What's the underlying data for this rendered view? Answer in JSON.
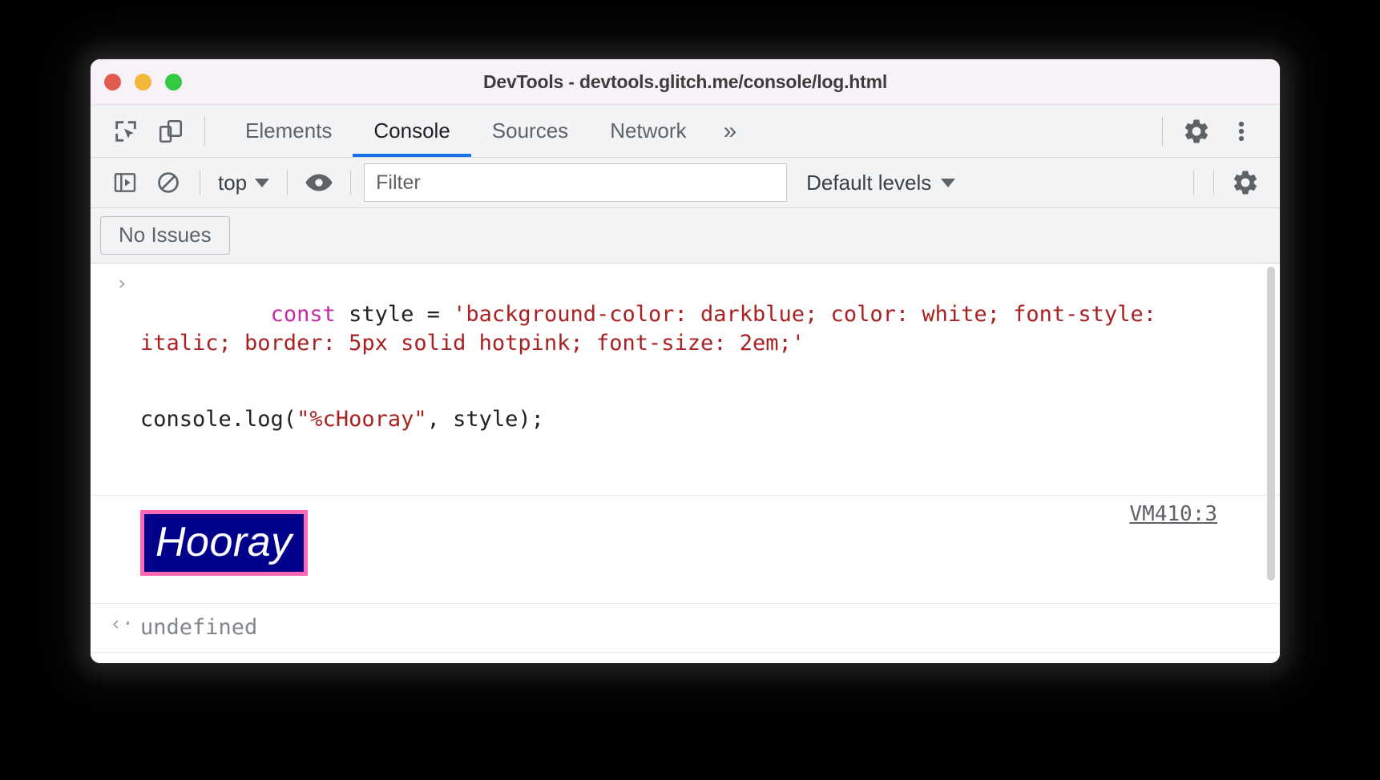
{
  "window": {
    "title": "DevTools - devtools.glitch.me/console/log.html",
    "traffic_lights": [
      {
        "name": "close",
        "color": "#e05c50"
      },
      {
        "name": "minimize",
        "color": "#f3b73c"
      },
      {
        "name": "maximize",
        "color": "#34c942"
      }
    ]
  },
  "tabbar": {
    "inspect_icon": "inspect-element-icon",
    "device_icon": "device-toolbar-icon",
    "tabs": [
      {
        "label": "Elements",
        "active": false
      },
      {
        "label": "Console",
        "active": true
      },
      {
        "label": "Sources",
        "active": false
      },
      {
        "label": "Network",
        "active": false
      }
    ],
    "more_tabs": "»",
    "settings_icon": "gear-icon",
    "menu_icon": "kebab-menu-icon",
    "active_tab_underline_color": "#1a73e8"
  },
  "console_toolbar": {
    "sidebar_toggle_icon": "console-sidebar-icon",
    "clear_icon": "clear-console-icon",
    "context_selector": "top",
    "context_caret": "▼",
    "eye_icon": "live-expression-eye-icon",
    "filter": {
      "placeholder": "Filter",
      "value": ""
    },
    "levels_label": "Default levels",
    "levels_caret": "▼",
    "settings_icon": "console-settings-gear-icon"
  },
  "issues_bar": {
    "button_label": "No Issues"
  },
  "console": {
    "entries": [
      {
        "type": "input",
        "gutter": "›",
        "line1": [
          {
            "text": "const",
            "token": "keyword"
          },
          {
            "text": " style = ",
            "token": "plain"
          },
          {
            "text": "'background-color: darkblue; color: white; font-",
            "token": "string"
          }
        ],
        "line2": [
          {
            "text": "style: italic; border: 5px solid hotpink; font-size: 2em;'",
            "token": "string"
          }
        ],
        "line3": [
          {
            "text": "console.log(",
            "token": "plain"
          },
          {
            "text": "\"%cHooray\"",
            "token": "string"
          },
          {
            "text": ", style);",
            "token": "plain"
          }
        ]
      },
      {
        "type": "styled-output",
        "text": "Hooray",
        "style": {
          "background_color": "darkblue",
          "color": "white",
          "font_style": "italic",
          "border": "5px solid hotpink",
          "font_size": "2em",
          "background_hex": "#00008b",
          "border_hex": "#ff69b4",
          "text_hex": "#ffffff"
        },
        "source": "VM410:3"
      },
      {
        "type": "result",
        "gutter": "‹·",
        "text": "undefined"
      },
      {
        "type": "prompt",
        "gutter": "›",
        "text": ""
      }
    ]
  }
}
